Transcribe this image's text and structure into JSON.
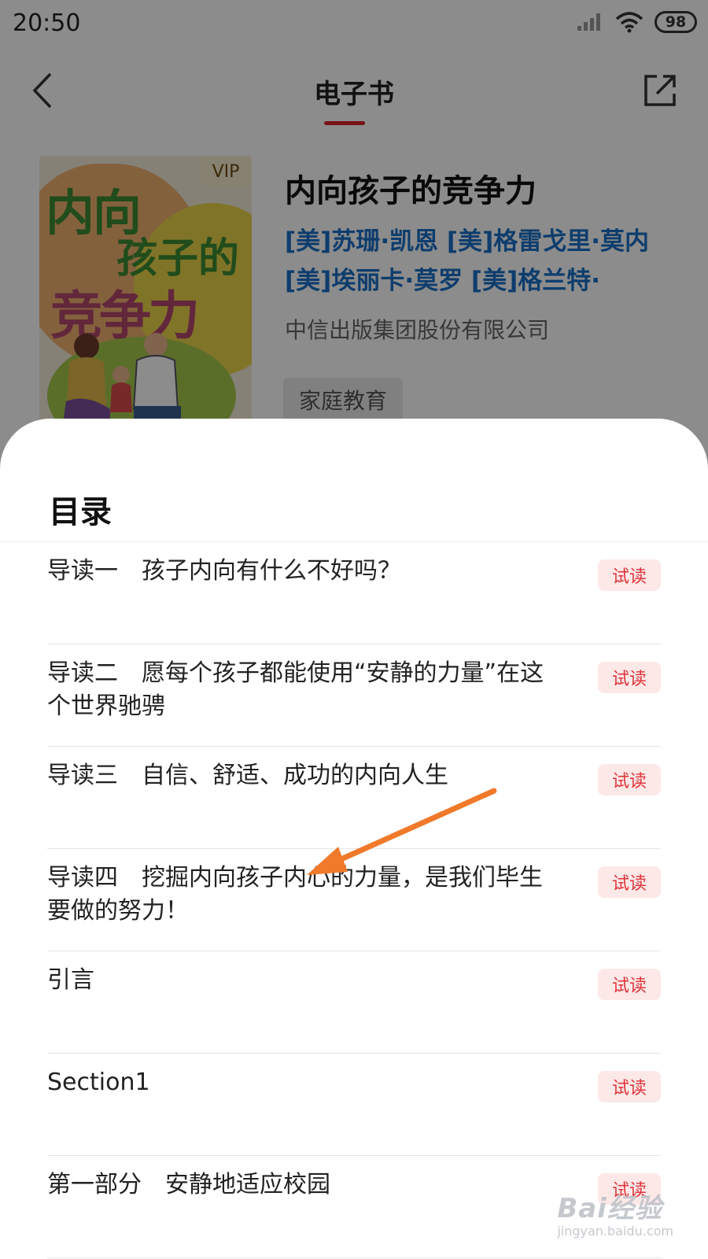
{
  "status_bar": {
    "time": "20:50",
    "battery": "98"
  },
  "nav": {
    "title": "电子书"
  },
  "book": {
    "cover": {
      "vip": "VIP",
      "line1": "内向",
      "line2": "孩子的",
      "line3": "竞争力"
    },
    "title": "内向孩子的竞争力",
    "authors": "[美]苏珊·凯恩 [美]格雷戈里·莫内 [美]埃丽卡·莫罗 [美]格兰特·",
    "publisher": "中信出版集团股份有限公司",
    "tag": "家庭教育"
  },
  "toc": {
    "title": "目录",
    "trial_label": "试读",
    "items": [
      {
        "text": "导读一　孩子内向有什么不好吗？"
      },
      {
        "text": "导读二　愿每个孩子都能使用“安静的力量”在这个世界驰骋"
      },
      {
        "text": "导读三　自信、舒适、成功的内向人生"
      },
      {
        "text": "导读四　挖掘内向孩子内心的力量，是我们毕生要做的努力！"
      },
      {
        "text": "引言"
      },
      {
        "text": "Section1"
      },
      {
        "text": "第一部分　安静地适应校园"
      }
    ]
  },
  "watermark": {
    "main": "Bai经验",
    "sub": "jingyan.baidu.com"
  },
  "colors": {
    "accent": "#d9202b",
    "author_link": "#1a6fc7",
    "trial_bg": "#fde8e8",
    "trial_text": "#e0353a",
    "annotation_arrow": "#f07a2a"
  }
}
